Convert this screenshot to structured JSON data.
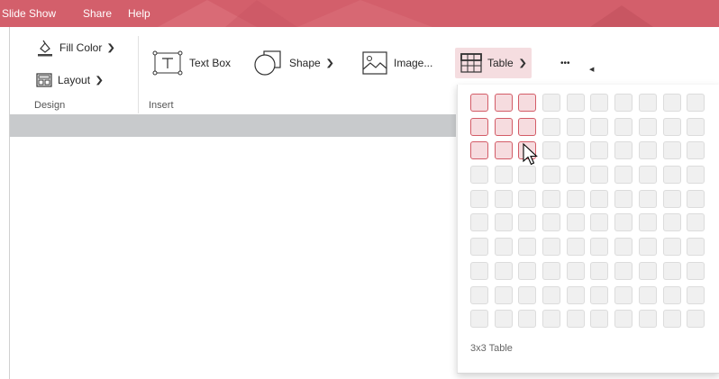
{
  "menu": {
    "items": [
      "Slide Show",
      "Share",
      "Help"
    ]
  },
  "ribbon": {
    "fill_color_label": "Fill Color",
    "layout_label": "Layout",
    "text_box_label": "Text Box",
    "shape_label": "Shape",
    "image_label": "Image...",
    "table_label": "Table",
    "more_label": "•••",
    "groups": {
      "design": "Design",
      "insert": "Insert"
    },
    "icons": {
      "fill_color": "paint-bucket-icon",
      "layout": "layout-icon",
      "text_box": "text-box-icon",
      "shape": "shape-icon",
      "image": "image-icon",
      "table": "table-grid-icon",
      "chevron": "chevron-down-icon",
      "more": "more-options-icon"
    }
  },
  "table_picker": {
    "rows": 10,
    "cols": 10,
    "selected_rows": 3,
    "selected_cols": 3,
    "caption": "3x3 Table"
  },
  "colors": {
    "accent": "#d35f6b",
    "cell_selected_fill": "#f6dcdf",
    "cell_selected_border": "#d35c67",
    "cell_fill": "#f0f0f0"
  }
}
